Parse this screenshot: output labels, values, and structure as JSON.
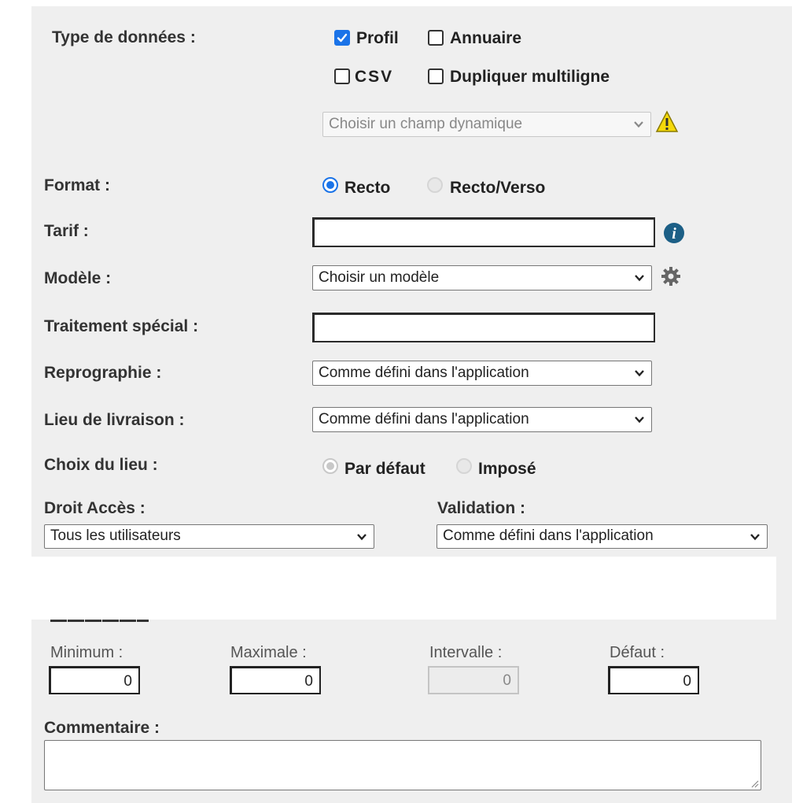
{
  "type_donnees": {
    "label": "Type de données :",
    "options": [
      {
        "label": "Profil",
        "checked": true
      },
      {
        "label": "Annuaire",
        "checked": false
      },
      {
        "label": "CSV",
        "checked": false
      },
      {
        "label": "Dupliquer multiligne",
        "checked": false
      }
    ],
    "champ_dynamique": {
      "value": "Choisir un champ dynamique",
      "icon": "warning-icon"
    }
  },
  "format": {
    "label": "Format :",
    "options": [
      {
        "label": "Recto",
        "selected": true
      },
      {
        "label": "Recto/Verso",
        "selected": false
      }
    ]
  },
  "tarif": {
    "label": "Tarif :",
    "value": "",
    "icon": "info-icon"
  },
  "modele": {
    "label": "Modèle :",
    "value": "Choisir un modèle",
    "icon": "gear-icon"
  },
  "traitement": {
    "label": "Traitement spécial :",
    "value": ""
  },
  "reprographie": {
    "label": "Reprographie :",
    "value": "Comme défini dans l'application"
  },
  "lieu_livraison": {
    "label": "Lieu de livraison :",
    "value": "Comme défini dans l'application"
  },
  "choix_lieu": {
    "label": "Choix du lieu :",
    "options": [
      {
        "label": "Par défaut",
        "selected": true
      },
      {
        "label": "Imposé",
        "selected": false
      }
    ]
  },
  "droit_acces": {
    "label": "Droit Accès :",
    "value": "Tous les utilisateurs"
  },
  "validation": {
    "label": "Validation :",
    "value": "Comme défini dans l'application"
  },
  "quantite": {
    "fields": [
      {
        "label": "Minimum :",
        "value": "0",
        "disabled": false
      },
      {
        "label": "Maximale :",
        "value": "0",
        "disabled": false
      },
      {
        "label": "Intervalle :",
        "value": "0",
        "disabled": true
      },
      {
        "label": "Défaut :",
        "value": "0",
        "disabled": false
      }
    ]
  },
  "commentaire": {
    "label": "Commentaire :",
    "value": ""
  }
}
